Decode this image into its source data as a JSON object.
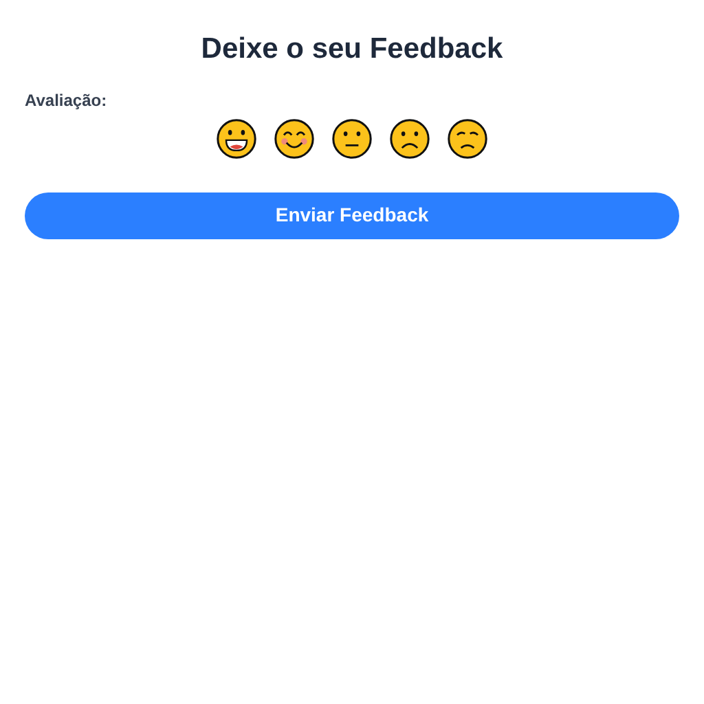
{
  "title": "Deixe o seu Feedback",
  "rating": {
    "label": "Avaliação:",
    "options": [
      {
        "kind": "grinning"
      },
      {
        "kind": "smiling"
      },
      {
        "kind": "neutral"
      },
      {
        "kind": "frowning"
      },
      {
        "kind": "pensive"
      }
    ]
  },
  "submit": {
    "label": "Enviar Feedback"
  }
}
